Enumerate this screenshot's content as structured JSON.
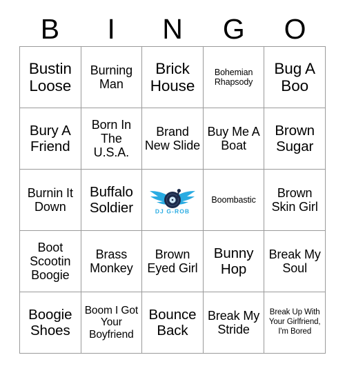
{
  "card": {
    "header_letters": [
      "B",
      "I",
      "N",
      "G",
      "O"
    ],
    "rows": [
      [
        {
          "text": "Bustin Loose",
          "size": "fs-xl"
        },
        {
          "text": "Burning Man",
          "size": "fs-md"
        },
        {
          "text": "Brick House",
          "size": "fs-xl"
        },
        {
          "text": "Bohemian Rhapsody",
          "size": "fs-xs"
        },
        {
          "text": "Bug A Boo",
          "size": "fs-xl"
        }
      ],
      [
        {
          "text": "Bury A Friend",
          "size": "fs-lg"
        },
        {
          "text": "Born In The U.S.A.",
          "size": "fs-md"
        },
        {
          "text": "Brand New Slide",
          "size": "fs-md"
        },
        {
          "text": "Buy Me A Boat",
          "size": "fs-md"
        },
        {
          "text": "Brown Sugar",
          "size": "fs-lg"
        }
      ],
      [
        {
          "text": "Burnin It Down",
          "size": "fs-md"
        },
        {
          "text": "Buffalo Soldier",
          "size": "fs-lg"
        },
        {
          "type": "free-space",
          "text": "",
          "size": "fs-md"
        },
        {
          "text": "Boombastic",
          "size": "fs-xs"
        },
        {
          "text": "Brown Skin Girl",
          "size": "fs-md"
        }
      ],
      [
        {
          "text": "Boot Scootin Boogie",
          "size": "fs-md"
        },
        {
          "text": "Brass Monkey",
          "size": "fs-md"
        },
        {
          "text": "Brown Eyed Girl",
          "size": "fs-md"
        },
        {
          "text": "Bunny Hop",
          "size": "fs-lg"
        },
        {
          "text": "Break My Soul",
          "size": "fs-md"
        }
      ],
      [
        {
          "text": "Boogie Shoes",
          "size": "fs-lg"
        },
        {
          "text": "Boom I Got Your Boyfriend",
          "size": "fs-sm"
        },
        {
          "text": "Bounce Back",
          "size": "fs-lg"
        },
        {
          "text": "Break My Stride",
          "size": "fs-md"
        },
        {
          "text": "Break Up With Your Girlfriend, I'm Bored",
          "size": "fs-xxs"
        }
      ]
    ]
  },
  "free_space": {
    "logo_text": "DJ G-ROB",
    "wing_color": "#29abe2",
    "record_color": "#1b2a4a",
    "record_highlight": "#cfe8f7"
  }
}
